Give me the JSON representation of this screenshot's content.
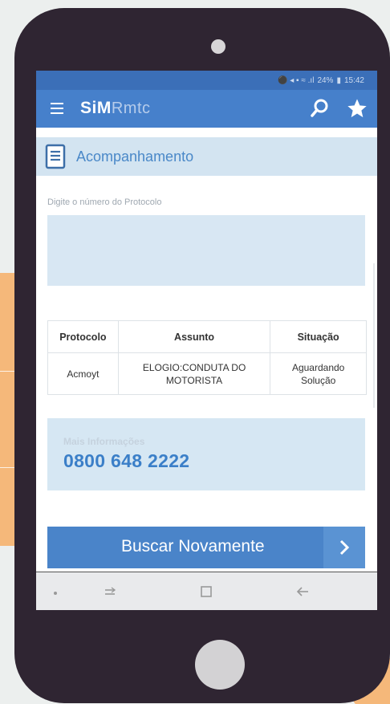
{
  "status_bar": {
    "battery": "24%",
    "time": "15:42"
  },
  "app_bar": {
    "brand_bold": "SiM",
    "brand_light": "Rmtc",
    "menu_icon": "menu-icon",
    "search_icon": "search-icon",
    "favorite_icon": "star-icon"
  },
  "section": {
    "title": "Acompanhamento",
    "icon": "document-icon"
  },
  "form": {
    "label": "Digite o número do Protocolo",
    "value": "",
    "placeholder": ""
  },
  "table": {
    "headers": [
      "Protocolo",
      "Assunto",
      "Situação"
    ],
    "rows": [
      {
        "protocolo": "Acmoyt",
        "assunto": "ELOGIO:CONDUTA DO MOTORISTA",
        "situacao": "Aguardando Solução"
      }
    ]
  },
  "info": {
    "label": "Mais Informações",
    "phone": "0800 648 2222"
  },
  "action": {
    "label": "Buscar Novamente",
    "icon": "chevron-right-icon"
  },
  "nav": {
    "items": [
      "recent-dot-icon",
      "recent-apps-icon",
      "home-square-icon",
      "back-icon"
    ]
  },
  "colors": {
    "primary": "#4680cb",
    "accent_light": "#d3e4f1",
    "phone_body": "#2f2532",
    "decor": "#f5b87a"
  }
}
